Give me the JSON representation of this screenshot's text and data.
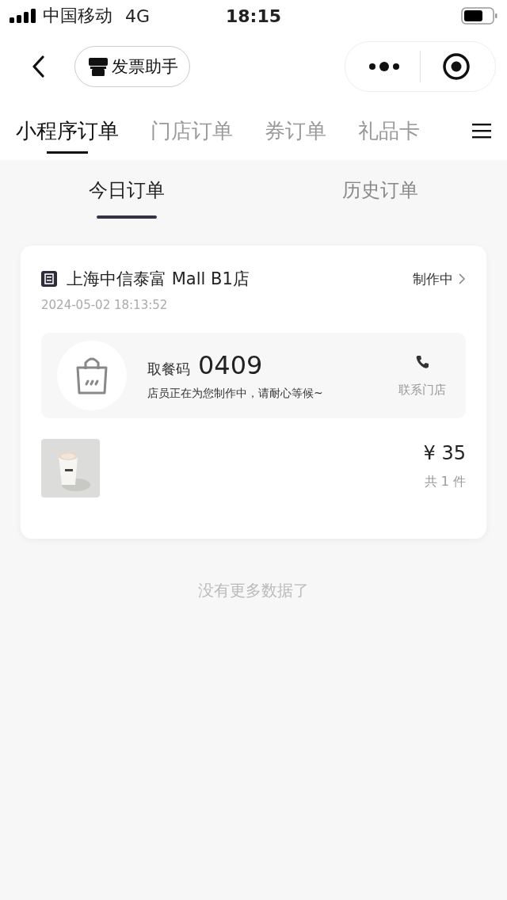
{
  "status_bar": {
    "carrier": "中国移动",
    "network": "4G",
    "time": "18:15"
  },
  "nav": {
    "invoice_button": "发票助手"
  },
  "category_tabs": [
    {
      "label": "小程序订单",
      "selected": true
    },
    {
      "label": "门店订单",
      "selected": false
    },
    {
      "label": "券订单",
      "selected": false
    },
    {
      "label": "礼品卡",
      "selected": false
    }
  ],
  "day_tabs": [
    {
      "label": "今日订单",
      "selected": true
    },
    {
      "label": "历史订单",
      "selected": false
    }
  ],
  "orders": [
    {
      "store": "上海中信泰富 Mall B1店",
      "status": "制作中",
      "time": "2024-05-02 18:13:52",
      "pickup_label": "取餐码",
      "pickup_code": "0409",
      "message": "店员正在为您制作中，请耐心等候~",
      "contact": "联系门店",
      "price": "¥ 35",
      "count": "共 1 件"
    }
  ],
  "footer": "没有更多数据了"
}
